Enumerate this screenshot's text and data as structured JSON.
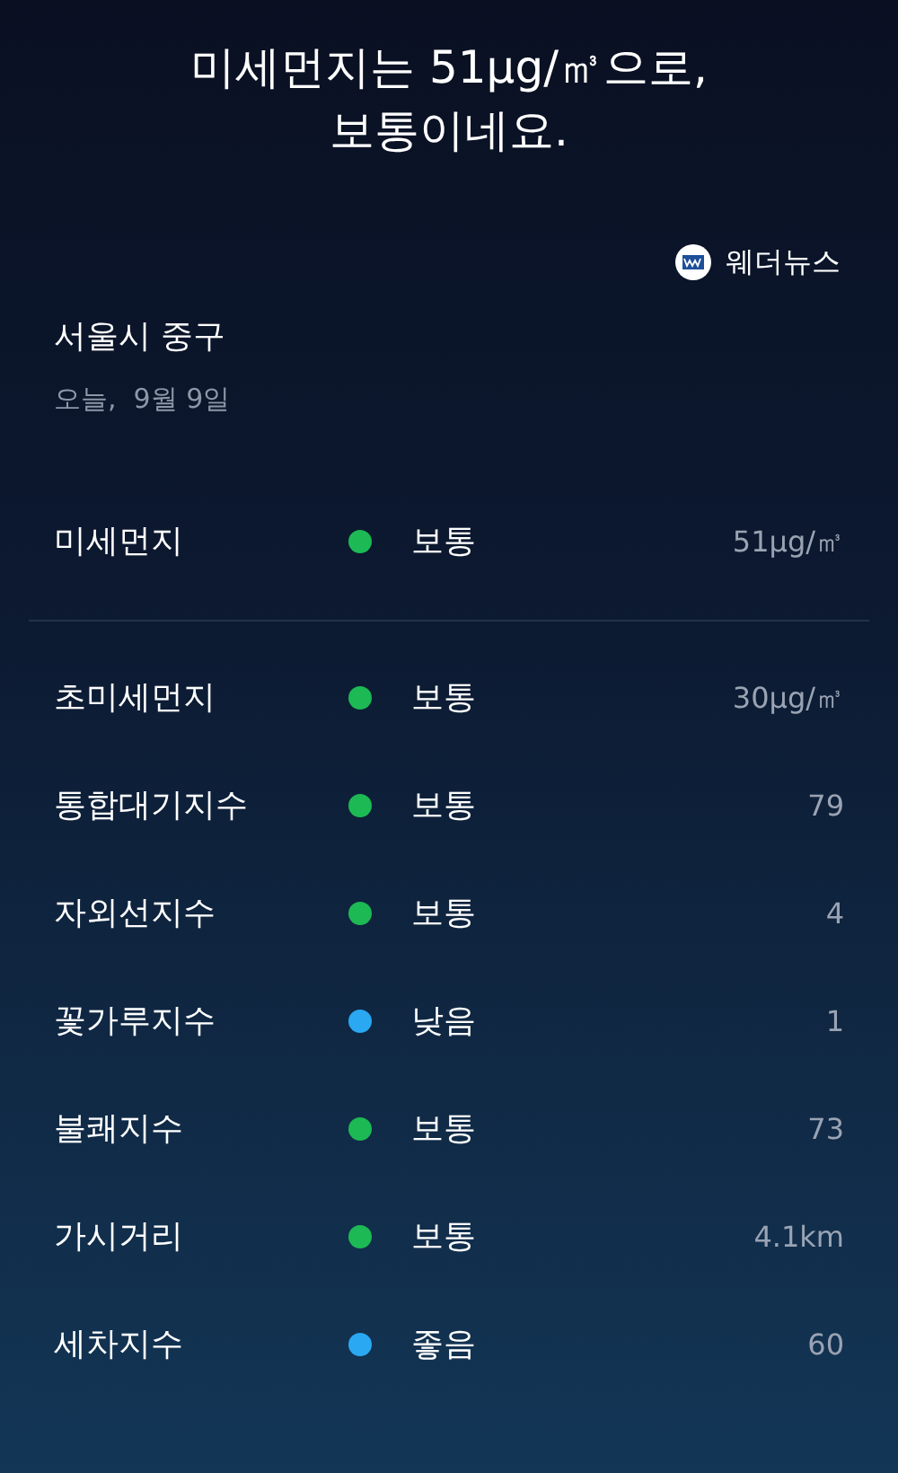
{
  "headline": [
    "미세먼지는 51μg/㎥으로,",
    "보통이네요."
  ],
  "source": {
    "name": "웨더뉴스"
  },
  "location": "서울시 중구",
  "date": "오늘,  9월 9일",
  "main": {
    "name": "미세먼지",
    "color": "#1db954",
    "grade": "보통",
    "value": "51μg/㎥"
  },
  "items": [
    {
      "name": "초미세먼지",
      "color": "#1db954",
      "grade": "보통",
      "value": "30μg/㎥"
    },
    {
      "name": "통합대기지수",
      "color": "#1db954",
      "grade": "보통",
      "value": "79"
    },
    {
      "name": "자외선지수",
      "color": "#1db954",
      "grade": "보통",
      "value": "4"
    },
    {
      "name": "꽃가루지수",
      "color": "#2aa8f2",
      "grade": "낮음",
      "value": "1"
    },
    {
      "name": "불쾌지수",
      "color": "#1db954",
      "grade": "보통",
      "value": "73"
    },
    {
      "name": "가시거리",
      "color": "#1db954",
      "grade": "보통",
      "value": "4.1km"
    },
    {
      "name": "세차지수",
      "color": "#2aa8f2",
      "grade": "좋음",
      "value": "60"
    }
  ]
}
